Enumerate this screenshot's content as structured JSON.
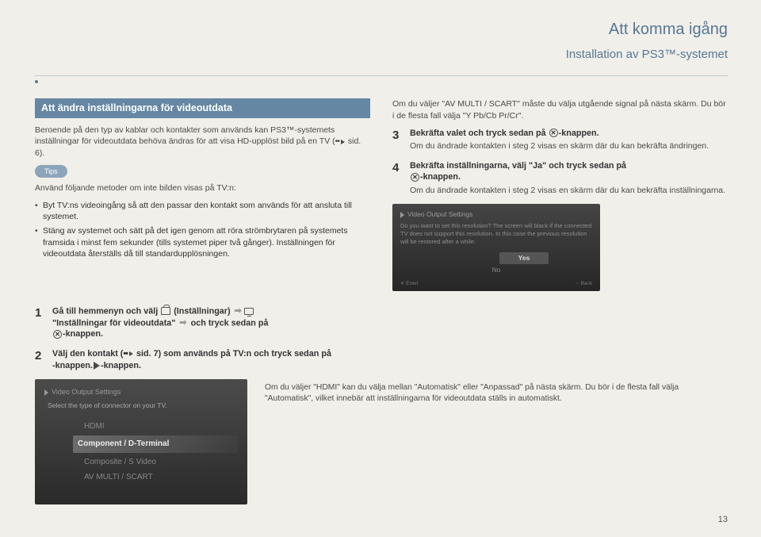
{
  "header": {
    "breadcrumb": "Att komma igång",
    "subhead": "Installation av PS3™-systemet"
  },
  "left": {
    "section_title": "Att ändra inställningarna för videoutdata",
    "intro_1": "Beroende på den typ av kablar och kontakter som används kan PS3™-systemets inställningar för videoutdata behöva ändras för att visa HD-upplöst bild på en TV (",
    "intro_ref": " sid. 6).",
    "tips_label": "Tips",
    "tips_intro": "Använd följande metoder om inte bilden visas på TV:n:",
    "tips": [
      "Byt TV:ns videoingång så att den passar den kontakt som används för att ansluta till systemet.",
      "Stäng av systemet och sätt på det igen genom att röra strömbrytaren på systemets framsida i minst fem sekunder (tills systemet piper två gånger). Inställningen för videoutdata återställs då till standardupplösningen."
    ],
    "steps": {
      "s1a": "Gå till hemmenyn och välj ",
      "s1_settings": " (Inställningar) ",
      "s1b": "\"Inställningar för videoutdata\" ",
      "s1c": " och tryck sedan på ",
      "s1d": "-knappen.",
      "s2a": "Välj den kontakt (",
      "s2_ref": " sid. 7) som används på TV:n och tryck sedan på ",
      "s2b": "-knappen."
    }
  },
  "right": {
    "p1": "Om du väljer \"AV MULTI / SCART\" måste du välja utgående signal på nästa skärm. Du bör i de flesta fall välja \"Y Pb/Cb Pr/Cr\".",
    "s3_title": "Bekräfta valet och tryck sedan på ",
    "s3_suffix": "-knappen.",
    "s3_body": "Om du ändrade kontakten i steg 2 visas en skärm där du kan bekräfta ändringen.",
    "s4_title_a": "Bekräfta inställningarna, välj \"Ja\" och tryck sedan på ",
    "s4_title_b": "-knappen.",
    "s4_body": "Om du ändrade kontakten i steg 2 visas en skärm där du kan bekräfta inställningarna."
  },
  "shot_left": {
    "title": "Video Output Settings",
    "prompt": "Select the type of connector on your TV.",
    "items": [
      "HDMI",
      "Component / D-Terminal",
      "Composite / S Video",
      "AV MULTI / SCART"
    ],
    "sel_index": 1,
    "caption": "Om du väljer \"HDMI\" kan du välja mellan \"Automatisk\" eller \"Anpassad\" på nästa skärm. Du bör i de flesta fall välja \"Automatisk\", vilket innebär att inställningarna för videoutdata ställs in automatiskt."
  },
  "shot_right": {
    "title": "Video Output Settings",
    "body": "Do you want to set this resolution? The screen will black if the connected TV does not support this resolution. In this case the previous resolution will be restored after a while.",
    "opt_sel": "Yes",
    "opt2": "No",
    "foot_l": "✕ Enter",
    "foot_r": "○ Back"
  },
  "page_number": "13"
}
